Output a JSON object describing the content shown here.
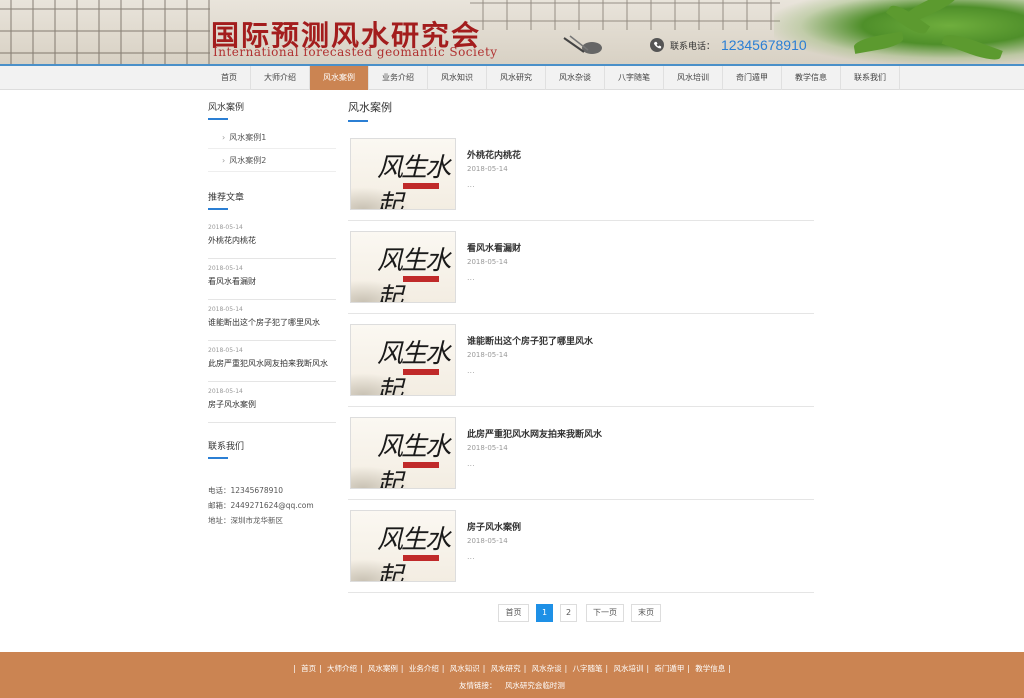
{
  "header": {
    "logo_cn": "国际预测风水研究会",
    "logo_en": "International forecasted geomantic Society",
    "phone_label": "联系电话：",
    "phone_number": "12345678910"
  },
  "nav": {
    "items": [
      "首页",
      "大师介绍",
      "风水案例",
      "业务介绍",
      "风水知识",
      "风水研究",
      "风水杂谈",
      "八字随笔",
      "风水培训",
      "奇门遁甲",
      "教学信息",
      "联系我们"
    ],
    "active_index": 2
  },
  "sidebar": {
    "category_title": "风水案例",
    "categories": [
      "风水案例1",
      "风水案例2"
    ],
    "recommend_title": "推荐文章",
    "recommended": [
      {
        "date": "2018-05-14",
        "title": "外桃花内桃花"
      },
      {
        "date": "2018-05-14",
        "title": "看风水看漏财"
      },
      {
        "date": "2018-05-14",
        "title": "谁能断出这个房子犯了哪里风水"
      },
      {
        "date": "2018-05-14",
        "title": "此房严重犯风水网友拍来我断风水"
      },
      {
        "date": "2018-05-14",
        "title": "房子风水案例"
      }
    ],
    "contact_title": "联系我们",
    "contact": {
      "phone": "电话：12345678910",
      "email": "邮箱：2449271624@qq.com",
      "address": "地址：深圳市龙华新区"
    }
  },
  "main": {
    "title": "风水案例",
    "thumb_calligraphy": "风生水起",
    "articles": [
      {
        "title": "外桃花内桃花",
        "date": "2018-05-14",
        "excerpt": "..."
      },
      {
        "title": "看风水看漏财",
        "date": "2018-05-14",
        "excerpt": "..."
      },
      {
        "title": "谁能断出这个房子犯了哪里风水",
        "date": "2018-05-14",
        "excerpt": "..."
      },
      {
        "title": "此房严重犯风水网友拍来我断风水",
        "date": "2018-05-14",
        "excerpt": "..."
      },
      {
        "title": "房子风水案例",
        "date": "2018-05-14",
        "excerpt": "..."
      }
    ]
  },
  "pagination": {
    "first": "首页",
    "pages": [
      "1",
      "2"
    ],
    "current": "1",
    "next": "下一页",
    "last": "末页"
  },
  "footer": {
    "links": [
      "首页",
      "大师介绍",
      "风水案例",
      "业务介绍",
      "风水知识",
      "风水研究",
      "风水杂谈",
      "八字随笔",
      "风水培训",
      "奇门遁甲",
      "教学信息"
    ],
    "friend_label": "友情链接：",
    "friend_links": [
      "风水研究会临时测"
    ]
  },
  "colors": {
    "accent_blue": "#2b7fd4",
    "nav_active": "#cb8452",
    "footer_bg": "#cb8452",
    "logo_red": "#a31d1d"
  }
}
